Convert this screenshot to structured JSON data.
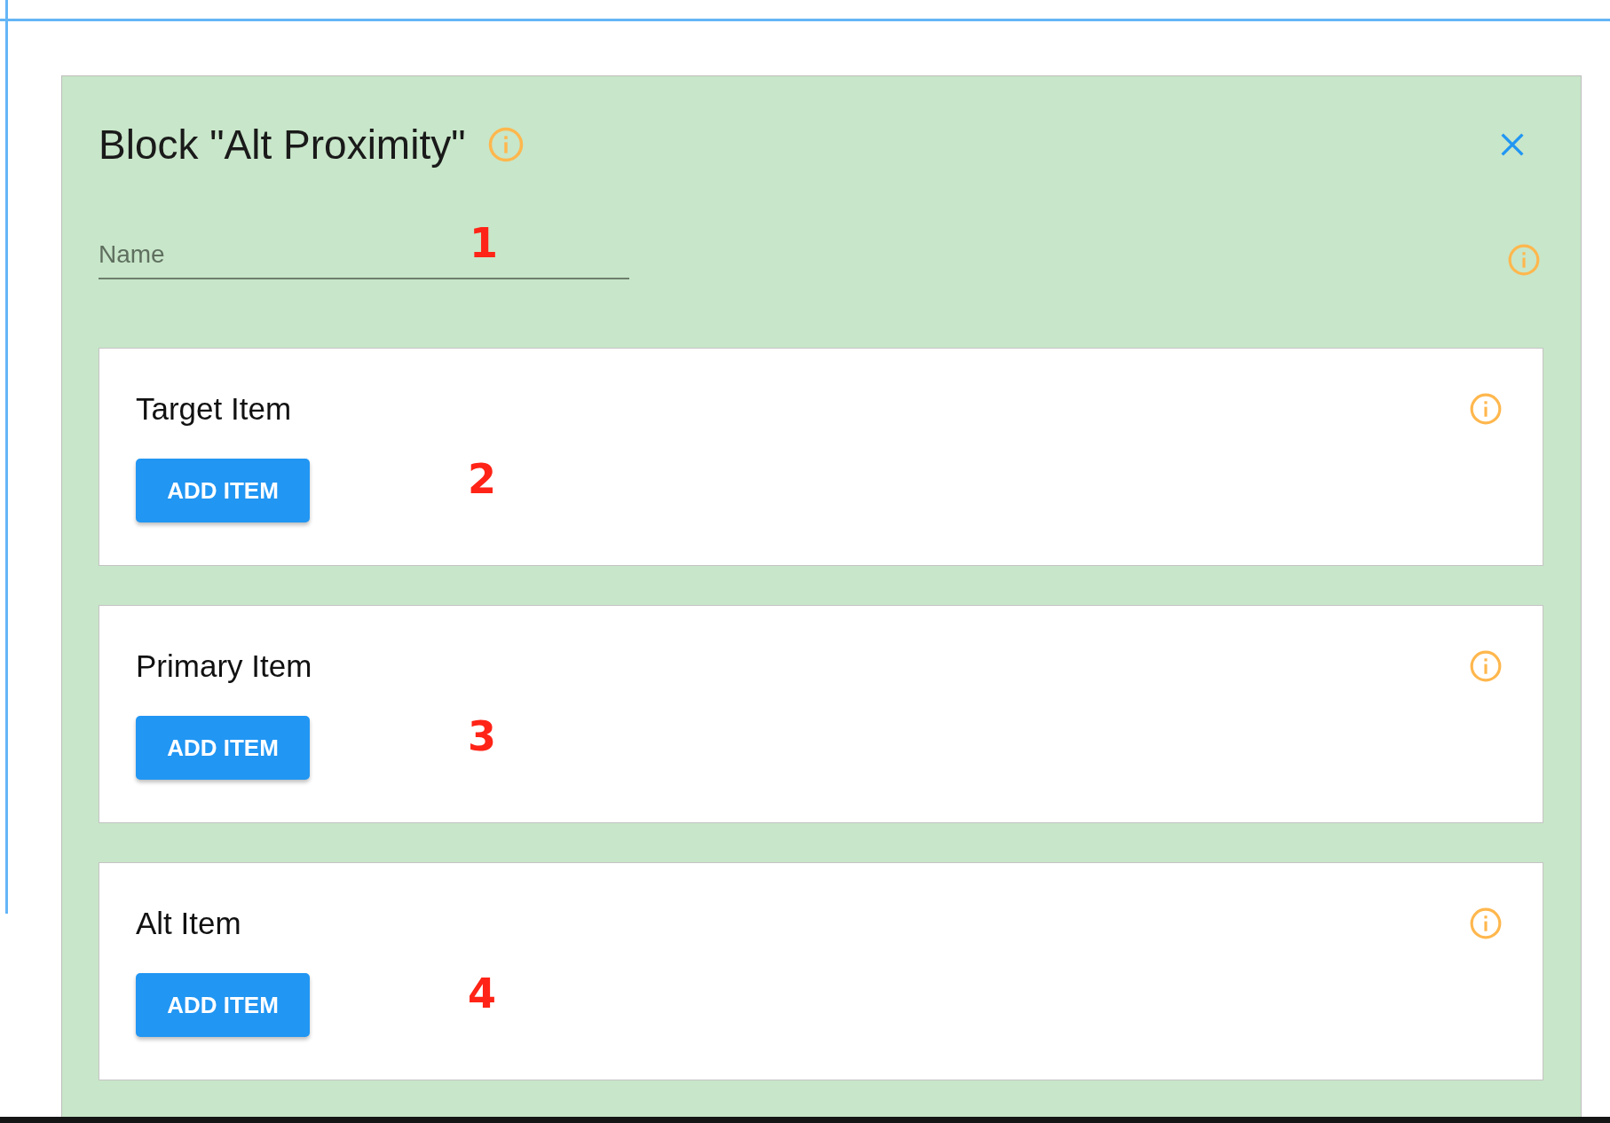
{
  "dialog": {
    "title": "Block \"Alt Proximity\""
  },
  "name_field": {
    "placeholder": "Name",
    "annotation": "1"
  },
  "sections": [
    {
      "title": "Target Item",
      "button": "ADD ITEM",
      "annotation": "2"
    },
    {
      "title": "Primary Item",
      "button": "ADD ITEM",
      "annotation": "3"
    },
    {
      "title": "Alt Item",
      "button": "ADD ITEM",
      "annotation": "4"
    }
  ]
}
